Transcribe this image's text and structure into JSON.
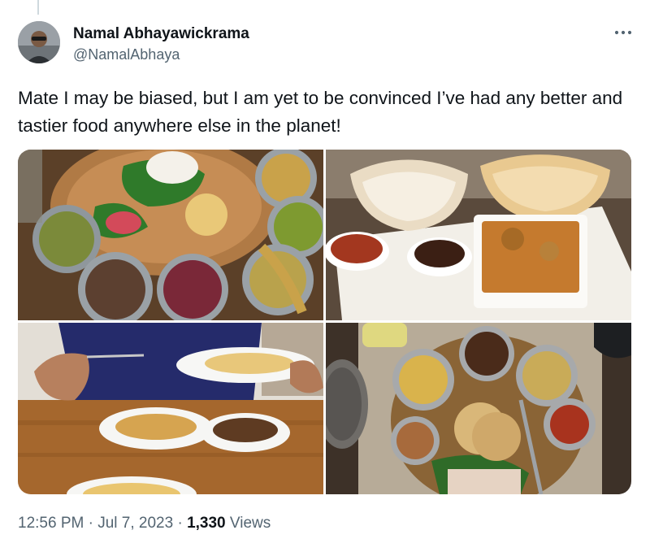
{
  "author": {
    "display_name": "Namal Abhayawickrama",
    "handle": "@NamalAbhaya"
  },
  "tweet": {
    "text": "Mate I may be biased, but I am yet to be convinced I’ve had any better and tastier food anywhere else in the planet!"
  },
  "media": [
    {
      "name": "rice-and-curry-platter-photo"
    },
    {
      "name": "hoppers-and-curries-photo"
    },
    {
      "name": "diner-eating-meal-photo"
    },
    {
      "name": "thali-with-roti-photo"
    }
  ],
  "meta": {
    "time": "12:56 PM",
    "separator": "·",
    "date": "Jul 7, 2023",
    "views_count": "1,330",
    "views_label": "Views"
  },
  "icons": {
    "more": "more-dots-icon"
  },
  "colors": {
    "text": "#0f1419",
    "secondary": "#536471",
    "divider": "#cfd9de"
  }
}
